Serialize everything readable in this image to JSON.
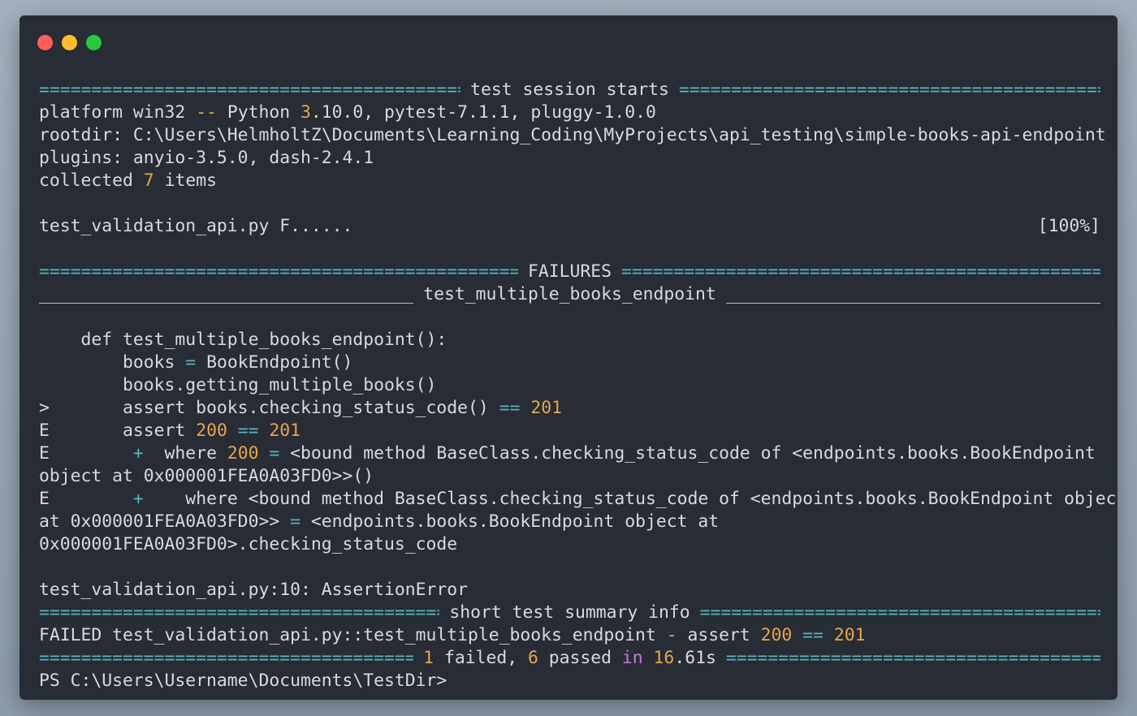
{
  "terminal": {
    "header": "test session starts",
    "platform_line": {
      "prefix": "platform win32 ",
      "sep": "--",
      "python": " Python ",
      "py_major": "3",
      "py_rest": ".10.0, pytest-7.1.1, pluggy-1.0.0"
    },
    "rootdir": "rootdir: C:\\Users\\HelmholtZ\\Documents\\Learning_Coding\\MyProjects\\api_testing\\simple-books-api-endpoint",
    "plugins": "plugins: anyio-3.5.0, dash-2.4.1",
    "collected": {
      "prefix": "collected ",
      "count": "7",
      "suffix": " items"
    },
    "progress": {
      "file": "test_validation_api.py F......",
      "percent": "[100%]"
    },
    "failures_header": "FAILURES",
    "test_header": "test_multiple_books_endpoint",
    "code": {
      "def_line": "    def test_multiple_books_endpoint():",
      "books_a": "        books ",
      "books_eq": "=",
      "books_b": " BookEndpoint()",
      "getting": "        books.getting_multiple_books()",
      "assert_prefix": ">       assert books.checking_status_code() ",
      "assert_op": "==",
      "assert_val": "201"
    },
    "errors": {
      "e1_prefix": "E       assert ",
      "e1_a": "200",
      "e1_op": "==",
      "e1_b": "201",
      "e2_prefix": "E        ",
      "e2_plus": "+",
      "e2_where": "  where ",
      "e2_val": "200",
      "e2_eq": "=",
      "e2_rest": " <bound method BaseClass.checking_status_code of <endpoints.books.BookEndpoint",
      "e2_cont": "object at 0x000001FEA0A03FD0>>()",
      "e3_prefix": "E        ",
      "e3_plus": "+",
      "e3_where": "    where <bound method BaseClass.checking_status_code of <endpoints.books.BookEndpoint object",
      "e3_cont_a": "at 0x000001FEA0A03FD0>> ",
      "e3_eq": "=",
      "e3_cont_b": " <endpoints.books.BookEndpoint object at",
      "e3_cont2": "0x000001FEA0A03FD0>.checking_status_code"
    },
    "assertion_error": "test_validation_api.py:10: AssertionError",
    "summary_header": "short test summary info",
    "failed_line": {
      "prefix": "FAILED test_validation_api.py::test_multiple_books_endpoint ",
      "dash": "-",
      "assert": " assert ",
      "a": "200",
      "op": "==",
      "b": "201"
    },
    "result": {
      "failed_count": "1",
      "failed_text": " failed, ",
      "passed_count": "6",
      "passed_text": " passed ",
      "in": "in",
      "time_num": "16",
      "time_rest": ".61s"
    },
    "prompt": "PS C:\\Users\\Username\\Documents\\TestDir>"
  },
  "rule_eq": "==========================================================================================================",
  "rule_us": "__________________________________________________________________________________________________________",
  "colors": {
    "cyan": "#56b6c2",
    "orange": "#e5a64e",
    "purple": "#c678dd",
    "text": "#d7dae0",
    "bg": "#282c34"
  }
}
